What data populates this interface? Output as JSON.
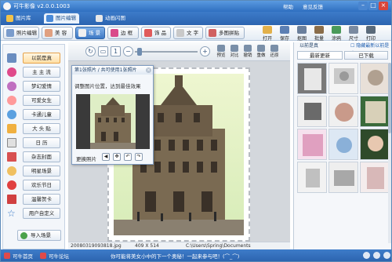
{
  "titlebar": {
    "title": "可牛影像 v2.0.0.1003",
    "link_help": "帮助",
    "link_feedback": "意见反馈",
    "min": "–",
    "max": "□",
    "close": "×"
  },
  "nav": {
    "tabs": [
      {
        "label": "图片库"
      },
      {
        "label": "图片编辑"
      },
      {
        "label": "动画闪图"
      }
    ]
  },
  "toolbar": {
    "buttons": [
      {
        "label": "照片编辑"
      },
      {
        "label": "美 容"
      },
      {
        "label": "场 景"
      },
      {
        "label": "边 框"
      },
      {
        "label": "饰 品"
      },
      {
        "label": "文 字"
      },
      {
        "label": "多图拼贴"
      }
    ],
    "right_tools": [
      {
        "label": "打开"
      },
      {
        "label": "保存"
      },
      {
        "label": "抠图"
      },
      {
        "label": "批量"
      },
      {
        "label": "涂鸦"
      },
      {
        "label": "尺寸"
      },
      {
        "label": "打印"
      }
    ]
  },
  "left_panel": {
    "items": [
      {
        "label": "以前是真"
      },
      {
        "label": "主 主 流"
      },
      {
        "label": "梦幻爱情"
      },
      {
        "label": "可爱女生"
      },
      {
        "label": "卡通儿童"
      },
      {
        "label": "大 头 贴"
      },
      {
        "label": "日 历"
      },
      {
        "label": "杂志封面"
      },
      {
        "label": "明星场景"
      },
      {
        "label": "欢乐节日"
      },
      {
        "label": "温馨贺卡"
      },
      {
        "label": "用户自定义"
      }
    ],
    "import_label": "导入场景"
  },
  "canvas_toolbar": {
    "tools": [
      {
        "label": "预览"
      },
      {
        "label": "对比"
      },
      {
        "label": "撤销"
      },
      {
        "label": "重做"
      },
      {
        "label": "还原"
      }
    ]
  },
  "dialog": {
    "title": "第1张照片 / 共可使用1张照片",
    "text": "调整图片位置，达到最佳效果",
    "change_label": "更换照片",
    "close": "×",
    "ctrl_left": "◀",
    "ctrl_move": "✥",
    "ctrl_rot_left": "↶",
    "ctrl_rot_right": "↷"
  },
  "right_panel": {
    "header": "以前是真",
    "checkbox_label": "隐藏最新以前是真",
    "tabs": [
      {
        "label": "最新更新"
      },
      {
        "label": "已下载"
      }
    ]
  },
  "info_bar": {
    "filename": "20080319093818.jpg",
    "dimensions": "409 X 514",
    "path": "C:\\Users\\Spring\\Documents"
  },
  "statusbar": {
    "home_link": "可牛首页",
    "forum_link": "可牛论坛",
    "message": "你可能将美女小中的下一个奥秘！一起来参与吧！(⌒_⌒)"
  },
  "colors": {
    "titlebar": "#2f6fc0",
    "accent_orange": "#e6a24a",
    "canvas_bg": "#d3d7dc"
  }
}
